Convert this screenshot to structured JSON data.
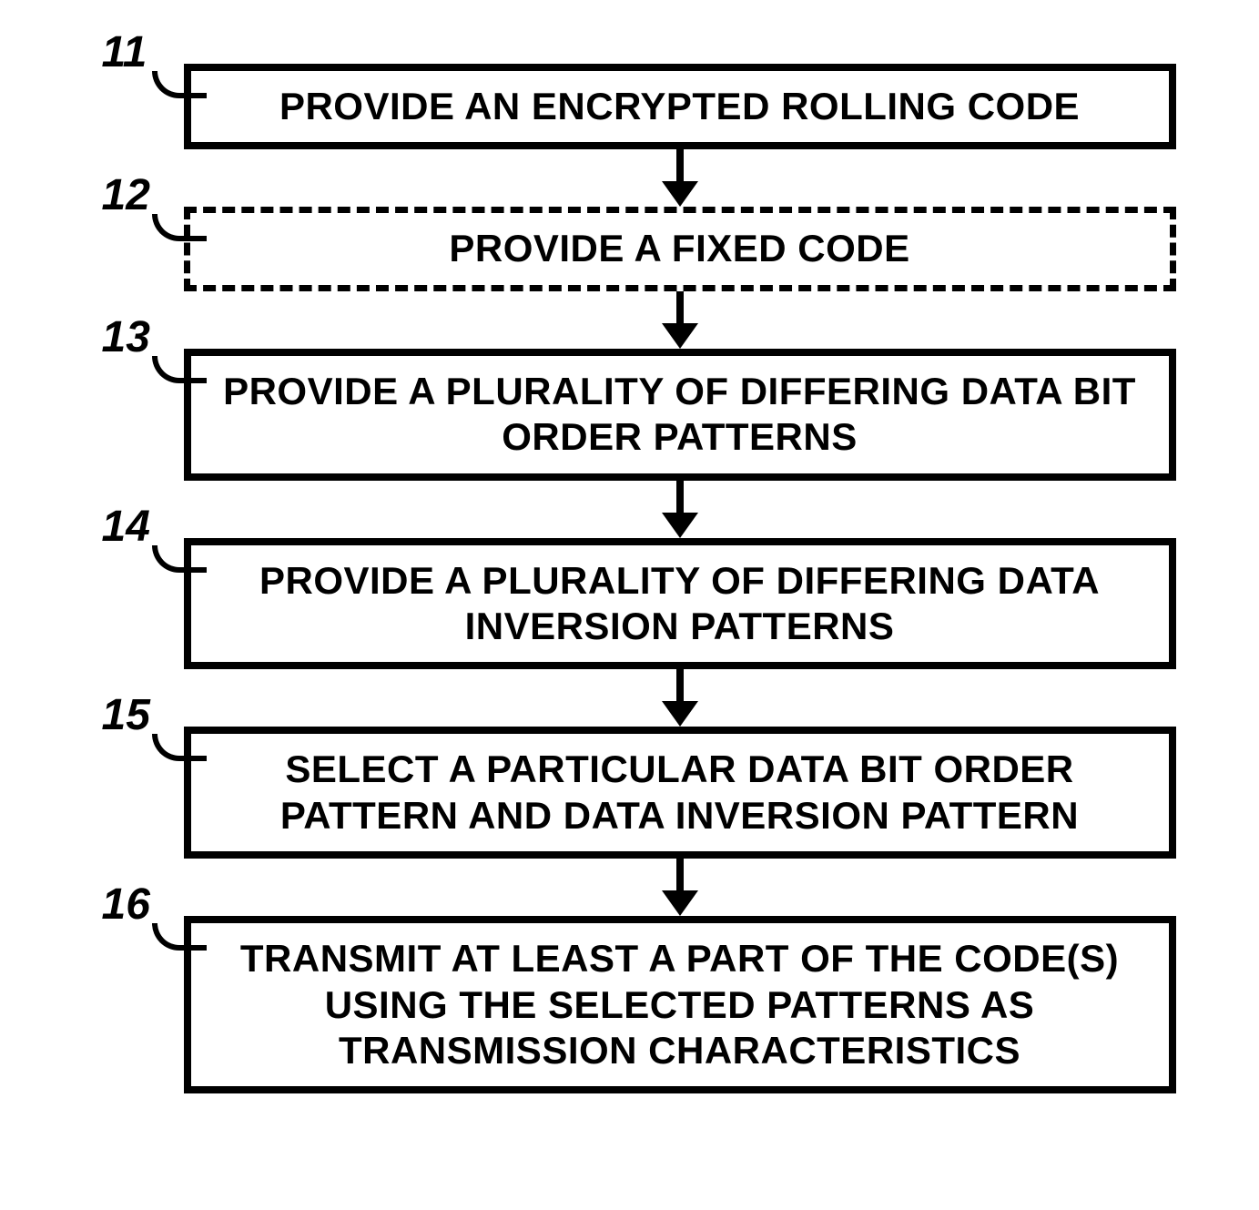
{
  "flowchart": {
    "steps": [
      {
        "number": "11",
        "text": "PROVIDE AN ENCRYPTED ROLLING CODE",
        "dashed": false
      },
      {
        "number": "12",
        "text": "PROVIDE A FIXED CODE",
        "dashed": true
      },
      {
        "number": "13",
        "text": "PROVIDE A PLURALITY OF DIFFERING DATA BIT ORDER PATTERNS",
        "dashed": false
      },
      {
        "number": "14",
        "text": "PROVIDE A PLURALITY OF DIFFERING DATA INVERSION PATTERNS",
        "dashed": false
      },
      {
        "number": "15",
        "text": "SELECT A PARTICULAR DATA BIT ORDER PATTERN AND DATA INVERSION PATTERN",
        "dashed": false
      },
      {
        "number": "16",
        "text": "TRANSMIT AT LEAST A PART OF THE CODE(S) USING THE SELECTED PATTERNS AS TRANSMISSION CHARACTERISTICS",
        "dashed": false
      }
    ]
  }
}
